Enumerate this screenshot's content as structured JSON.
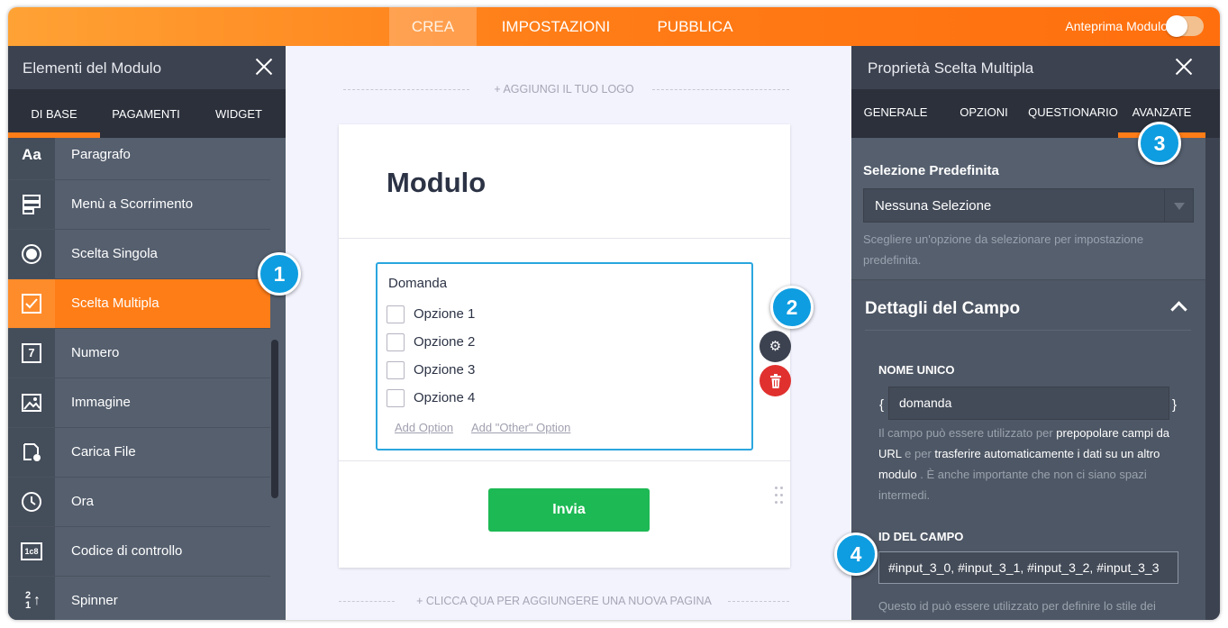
{
  "topbar": {
    "tabs": [
      "CREA",
      "IMPOSTAZIONI",
      "PUBBLICA"
    ],
    "preview_label": "Anteprima Modulo"
  },
  "left_panel": {
    "title": "Elementi del Modulo",
    "tabs": [
      "DI BASE",
      "PAGAMENTI",
      "WIDGET"
    ],
    "items": [
      {
        "label": "Paragrafo",
        "icon": "paragraph-icon",
        "icon_text": "Aa"
      },
      {
        "label": "Menù a Scorrimento",
        "icon": "dropdown-icon"
      },
      {
        "label": "Scelta Singola",
        "icon": "radio-icon"
      },
      {
        "label": "Scelta Multipla",
        "icon": "checkbox-icon",
        "active": true
      },
      {
        "label": "Numero",
        "icon": "number-icon",
        "icon_text": "7"
      },
      {
        "label": "Immagine",
        "icon": "image-icon"
      },
      {
        "label": "Carica File",
        "icon": "file-upload-icon"
      },
      {
        "label": "Ora",
        "icon": "clock-icon"
      },
      {
        "label": "Codice di controllo",
        "icon": "captcha-icon",
        "icon_text": "1c8"
      },
      {
        "label": "Spinner",
        "icon": "spinner-icon",
        "icon_text": "2 1"
      }
    ]
  },
  "canvas": {
    "add_logo": "+ AGGIUNGI IL TUO LOGO",
    "form_title": "Modulo",
    "question": {
      "label": "Domanda",
      "options": [
        "Opzione 1",
        "Opzione 2",
        "Opzione 3",
        "Opzione 4"
      ],
      "add_option": "Add Option",
      "add_other": "Add \"Other\" Option"
    },
    "submit": "Invia",
    "add_page": "+ CLICCA QUA PER AGGIUNGERE UNA NUOVA PAGINA"
  },
  "badges": [
    "1",
    "2",
    "3",
    "4"
  ],
  "right_panel": {
    "title": "Proprietà Scelta Multipla",
    "tabs": [
      "GENERALE",
      "OPZIONI",
      "QUESTIONARIO",
      "AVANZATE"
    ],
    "default_selection": {
      "title": "Selezione Predefinita",
      "value": "Nessuna Selezione",
      "help": "Scegliere un'opzione da selezionare per impostazione predefinita."
    },
    "field_details": {
      "title": "Dettagli del Campo",
      "unique_name_label": "NOME UNICO",
      "open_brace": "{",
      "close_brace": "}",
      "unique_name_value": "domanda",
      "help_1": "Il campo può essere utilizzato per ",
      "help_link_1": "prepopolare campi da URL",
      "help_2": " e per ",
      "help_link_2": "trasferire automaticamente i dati su un altro modulo",
      "help_3": " . È anche importante che non ci siano spazi intermedi.",
      "field_id_label": "ID DEL CAMPO",
      "field_id_value": "#input_3_0, #input_3_1, #input_3_2, #input_3_3",
      "field_id_help": "Questo id può essere utilizzato per definire lo stile dei"
    }
  },
  "colors": {
    "accent": "#ff7d17",
    "badge": "#0e9de0",
    "submit": "#1db954",
    "delete": "#e0312e"
  }
}
